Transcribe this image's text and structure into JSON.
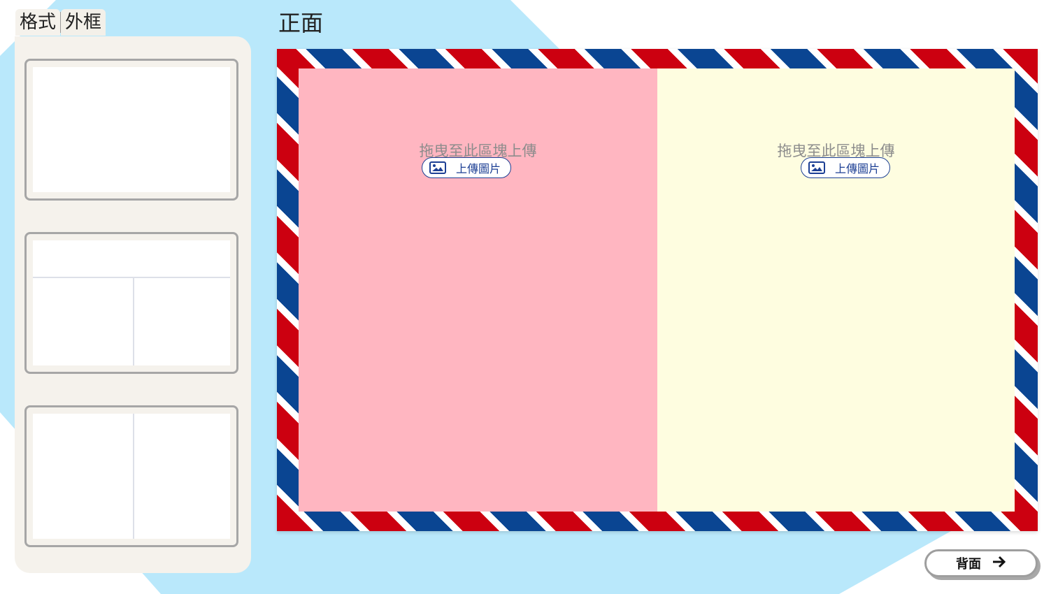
{
  "tabs": [
    {
      "label": "格式",
      "active": true
    },
    {
      "label": "外框",
      "active": false
    }
  ],
  "layouts": [
    {
      "name": "single"
    },
    {
      "name": "top-bar-two-columns"
    },
    {
      "name": "two-columns"
    }
  ],
  "canvas": {
    "title": "正面",
    "slots": [
      {
        "drop_text": "拖曳至此區塊上傳",
        "upload_label": "上傳圖片",
        "color": "#ffb6c1"
      },
      {
        "drop_text": "拖曳至此區塊上傳",
        "upload_label": "上傳圖片",
        "color": "#fefde0"
      }
    ]
  },
  "nav": {
    "back_label": "背面",
    "icon": "arrow-right-icon"
  },
  "colors": {
    "background_shape": "#b9e8fb",
    "panel": "#f5f2ec",
    "stripe_red": "#cc0010",
    "stripe_blue": "#0a4592",
    "button_blue": "#1c3f94"
  }
}
